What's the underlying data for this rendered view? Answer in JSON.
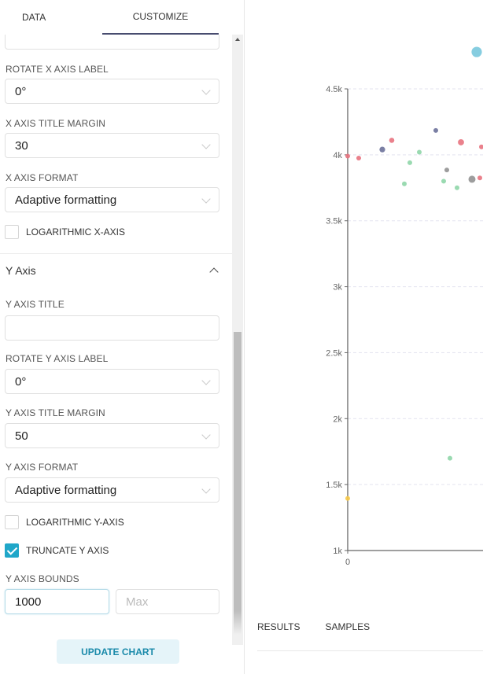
{
  "sidebar": {
    "tabs": [
      {
        "label": "DATA",
        "active": false
      },
      {
        "label": "CUSTOMIZE",
        "active": true
      }
    ],
    "x_axis": {
      "rotate_label": {
        "label": "ROTATE X AXIS LABEL",
        "value": "0°"
      },
      "title_margin": {
        "label": "X AXIS TITLE MARGIN",
        "value": "30"
      },
      "format": {
        "label": "X AXIS FORMAT",
        "value": "Adaptive formatting"
      },
      "logarithmic": {
        "label": "LOGARITHMIC X-AXIS",
        "checked": false
      }
    },
    "y_axis": {
      "section_title": "Y Axis",
      "title": {
        "label": "Y AXIS TITLE",
        "value": ""
      },
      "rotate_label": {
        "label": "ROTATE Y AXIS LABEL",
        "value": "0°"
      },
      "title_margin": {
        "label": "Y AXIS TITLE MARGIN",
        "value": "50"
      },
      "format": {
        "label": "Y AXIS FORMAT",
        "value": "Adaptive formatting"
      },
      "logarithmic": {
        "label": "LOGARITHMIC Y-AXIS",
        "checked": false
      },
      "truncate": {
        "label": "TRUNCATE Y AXIS",
        "checked": true
      },
      "bounds": {
        "label": "Y AXIS BOUNDS",
        "min_value": "1000",
        "max_placeholder": "Max"
      }
    },
    "update_button": "UPDATE CHART"
  },
  "bottom_tabs": [
    "RESULTS",
    "SAMPLES"
  ],
  "chart_data": {
    "type": "scatter",
    "title": "",
    "xlabel": "",
    "ylabel": "",
    "ylim": [
      1000,
      4500
    ],
    "y_ticks": [
      "1k",
      "1.5k",
      "2k",
      "2.5k",
      "3k",
      "3.5k",
      "4k",
      "4.5k"
    ],
    "y_tick_values": [
      1000,
      1500,
      2000,
      2500,
      3000,
      3500,
      4000,
      4500
    ],
    "x_ticks": [
      "0"
    ],
    "grid": true,
    "colors": {
      "red": "#e8737f",
      "navy": "#6c719a",
      "green": "#8fd6a8",
      "gray": "#929292",
      "yellow": "#f7c948",
      "cyan": "#79c8dd"
    },
    "points": [
      {
        "x": 0,
        "y": 3990,
        "color": "red",
        "size": 1
      },
      {
        "x": 14,
        "y": 3975,
        "color": "red",
        "size": 1
      },
      {
        "x": 44,
        "y": 4040,
        "color": "navy",
        "size": 1.2
      },
      {
        "x": 56,
        "y": 4110,
        "color": "red",
        "size": 1.1
      },
      {
        "x": 72,
        "y": 3780,
        "color": "green",
        "size": 1
      },
      {
        "x": 79,
        "y": 3940,
        "color": "green",
        "size": 1
      },
      {
        "x": 91,
        "y": 4020,
        "color": "green",
        "size": 1
      },
      {
        "x": 112,
        "y": 4185,
        "color": "navy",
        "size": 1
      },
      {
        "x": 122,
        "y": 3800,
        "color": "green",
        "size": 1
      },
      {
        "x": 126,
        "y": 3885,
        "color": "gray",
        "size": 1
      },
      {
        "x": 139,
        "y": 3750,
        "color": "green",
        "size": 1
      },
      {
        "x": 144,
        "y": 4095,
        "color": "red",
        "size": 1.3
      },
      {
        "x": 158,
        "y": 3815,
        "color": "gray",
        "size": 1.5
      },
      {
        "x": 168,
        "y": 3825,
        "color": "red",
        "size": 1
      },
      {
        "x": 170,
        "y": 4060,
        "color": "red",
        "size": 1
      },
      {
        "x": 130,
        "y": 1700,
        "color": "green",
        "size": 1
      },
      {
        "x": 0,
        "y": 1395,
        "color": "yellow",
        "size": 1
      },
      {
        "x": 164,
        "y": 4780,
        "color": "cyan",
        "size": 2.2
      }
    ]
  }
}
